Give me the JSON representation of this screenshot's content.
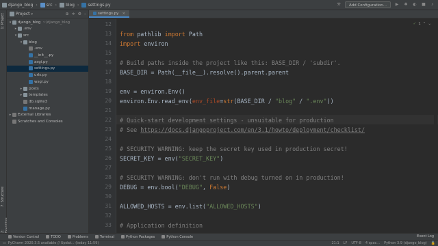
{
  "breadcrumbs": [
    "django_blog",
    "src",
    "blog",
    "settings.py"
  ],
  "nav": {
    "add_config": "Add Configuration..."
  },
  "side_tabs": {
    "project": "1: Project",
    "structure": "7: Structure",
    "favorites": "2: Favorites"
  },
  "project_panel": {
    "title": "Project",
    "tree": [
      {
        "label": "django_blog",
        "extra": "~/django_blog",
        "indent": 0,
        "arrow": "▾",
        "kind": "folder"
      },
      {
        "label": ".env",
        "extra": "",
        "indent": 1,
        "arrow": "▸",
        "kind": "folder"
      },
      {
        "label": "src",
        "extra": "",
        "indent": 1,
        "arrow": "▾",
        "kind": "folder"
      },
      {
        "label": "blog",
        "extra": "",
        "indent": 2,
        "arrow": "▾",
        "kind": "folder"
      },
      {
        "label": ".env",
        "extra": "",
        "indent": 3,
        "arrow": "",
        "kind": "file"
      },
      {
        "label": "__init__.py",
        "extra": "",
        "indent": 3,
        "arrow": "",
        "kind": "py"
      },
      {
        "label": "asgi.py",
        "extra": "",
        "indent": 3,
        "arrow": "",
        "kind": "py"
      },
      {
        "label": "settings.py",
        "extra": "",
        "indent": 3,
        "arrow": "",
        "kind": "py",
        "selected": true
      },
      {
        "label": "urls.py",
        "extra": "",
        "indent": 3,
        "arrow": "",
        "kind": "py"
      },
      {
        "label": "wsgi.py",
        "extra": "",
        "indent": 3,
        "arrow": "",
        "kind": "py"
      },
      {
        "label": "posts",
        "extra": "",
        "indent": 2,
        "arrow": "▸",
        "kind": "folder"
      },
      {
        "label": "templates",
        "extra": "",
        "indent": 2,
        "arrow": "▸",
        "kind": "folder"
      },
      {
        "label": "db.sqlite3",
        "extra": "",
        "indent": 2,
        "arrow": "",
        "kind": "file"
      },
      {
        "label": "manage.py",
        "extra": "",
        "indent": 2,
        "arrow": "",
        "kind": "py"
      },
      {
        "label": "External Libraries",
        "extra": "",
        "indent": 0,
        "arrow": "▸",
        "kind": "lib"
      },
      {
        "label": "Scratches and Consoles",
        "extra": "",
        "indent": 0,
        "arrow": "",
        "kind": "lib"
      }
    ]
  },
  "editor": {
    "tab": "settings.py",
    "inspection": "1",
    "lines": [
      {
        "num": "12",
        "tokens": []
      },
      {
        "num": "13",
        "tokens": [
          {
            "t": "from ",
            "c": "kw"
          },
          {
            "t": "pathlib ",
            "c": ""
          },
          {
            "t": "import ",
            "c": "kw"
          },
          {
            "t": "Path",
            "c": ""
          }
        ]
      },
      {
        "num": "14",
        "tokens": [
          {
            "t": "import ",
            "c": "kw"
          },
          {
            "t": "environ",
            "c": ""
          }
        ]
      },
      {
        "num": "15",
        "tokens": []
      },
      {
        "num": "16",
        "tokens": [
          {
            "t": "# Build paths inside the project like this: BASE_DIR / 'subdir'.",
            "c": "cm"
          }
        ]
      },
      {
        "num": "17",
        "tokens": [
          {
            "t": "BASE_DIR = Path(__file__).resolve().parent.parent",
            "c": ""
          }
        ]
      },
      {
        "num": "18",
        "tokens": []
      },
      {
        "num": "19",
        "tokens": [
          {
            "t": "env = environ.Env()",
            "c": ""
          }
        ]
      },
      {
        "num": "20",
        "tokens": [
          {
            "t": "environ.Env.read_env(",
            "c": ""
          },
          {
            "t": "env_file",
            "c": "pa"
          },
          {
            "t": "=",
            "c": ""
          },
          {
            "t": "str",
            "c": "kw"
          },
          {
            "t": "(BASE_DIR / ",
            "c": ""
          },
          {
            "t": "\"blog\"",
            "c": "st"
          },
          {
            "t": " / ",
            "c": ""
          },
          {
            "t": "\".env\"",
            "c": "st"
          },
          {
            "t": "))",
            "c": ""
          }
        ]
      },
      {
        "num": "21",
        "tokens": []
      },
      {
        "num": "22",
        "tokens": [
          {
            "t": "# Quick-start development settings - unsuitable for production",
            "c": "cm"
          }
        ]
      },
      {
        "num": "23",
        "tokens": [
          {
            "t": "# See ",
            "c": "cm"
          },
          {
            "t": "https://docs.djangoproject.com/en/3.1/howto/deployment/checklist/",
            "c": "lnk"
          }
        ]
      },
      {
        "num": "24",
        "tokens": []
      },
      {
        "num": "25",
        "tokens": [
          {
            "t": "# SECURITY WARNING: keep the secret key used in production secret!",
            "c": "cm"
          }
        ]
      },
      {
        "num": "26",
        "tokens": [
          {
            "t": "SECRET_KEY = env(",
            "c": ""
          },
          {
            "t": "\"SECRET_KEY\"",
            "c": "st"
          },
          {
            "t": ")",
            "c": ""
          }
        ]
      },
      {
        "num": "27",
        "tokens": []
      },
      {
        "num": "28",
        "tokens": [
          {
            "t": "# SECURITY WARNING: don't run with debug turned on in production!",
            "c": "cm"
          }
        ]
      },
      {
        "num": "29",
        "tokens": [
          {
            "t": "DEBUG = env.bool(",
            "c": ""
          },
          {
            "t": "\"DEBUG\"",
            "c": "st"
          },
          {
            "t": ", ",
            "c": ""
          },
          {
            "t": "False",
            "c": "kw"
          },
          {
            "t": ")",
            "c": ""
          }
        ]
      },
      {
        "num": "30",
        "tokens": []
      },
      {
        "num": "31",
        "tokens": [
          {
            "t": "ALLOWED_HOSTS = env.list(",
            "c": ""
          },
          {
            "t": "\"ALLOWED_HOSTS\"",
            "c": "st"
          },
          {
            "t": ")",
            "c": ""
          }
        ]
      },
      {
        "num": "32",
        "tokens": []
      },
      {
        "num": "33",
        "tokens": [
          {
            "t": "# Application definition",
            "c": "cm"
          }
        ]
      }
    ]
  },
  "tool_windows": [
    "Version Control",
    "TODO",
    "Problems",
    "Terminal",
    "Python Packages",
    "Python Console"
  ],
  "event_log": "Event Log",
  "status": {
    "message": "PyCharm 2020.3.5 available // Updat... (today 11:59)",
    "position": "21:1",
    "line_sep": "LF",
    "encoding": "UTF-8",
    "indent": "4 spac...",
    "interpreter": "Python 3.9 (django_blog)"
  },
  "colors": {
    "keyword": "#cc7832",
    "comment": "#808080",
    "string": "#6a8759",
    "param": "#aa4926",
    "text": "#a9b7c6",
    "selection": "#0d293e"
  }
}
